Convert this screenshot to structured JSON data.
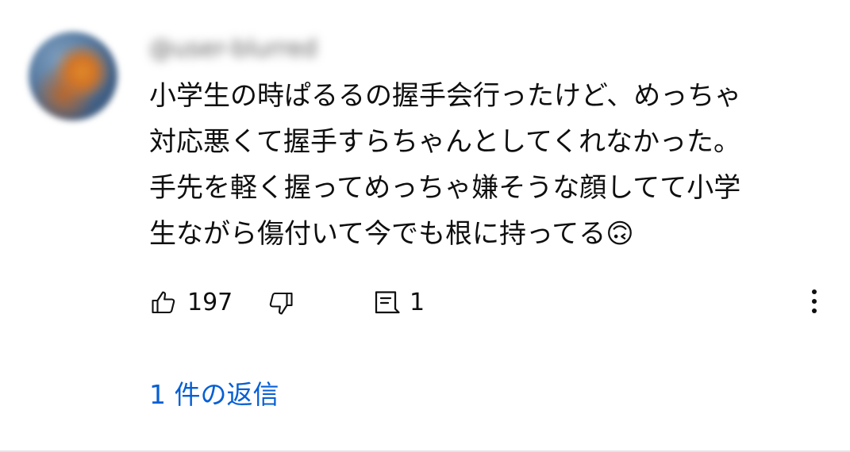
{
  "comment": {
    "author": "@user-blurred",
    "text_lines": [
      "小学生の時ぱるるの握手会行ったけど、めっちゃ",
      "対応悪くて握手すらちゃんとしてくれなかった。",
      "手先を軽く握ってめっちゃ嫌そうな顔してて小学",
      "生ながら傷付いて今でも根に持ってる🙃"
    ],
    "like_count": "197",
    "reply_count": "1",
    "replies_link": "1 件の返信"
  },
  "icons": {
    "like": "thumbs-up-icon",
    "dislike": "thumbs-down-icon",
    "reply": "comment-icon",
    "more": "more-vertical-icon"
  },
  "colors": {
    "text": "#0f0f0f",
    "link": "#065fd4",
    "avatar": "#d27426"
  }
}
